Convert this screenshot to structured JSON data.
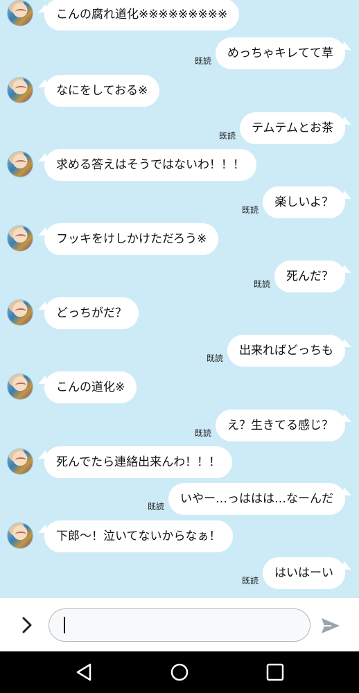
{
  "read_label": "既読",
  "messages": [
    {
      "side": "in",
      "text": "こんの腐れ道化※※※※※※※※※"
    },
    {
      "side": "out",
      "text": "めっちゃキレてて草",
      "read": true
    },
    {
      "side": "in",
      "text": "なにをしておる※"
    },
    {
      "side": "out",
      "text": "テムテムとお茶",
      "read": true
    },
    {
      "side": "in",
      "text": "求める答えはそうではないわ！！！"
    },
    {
      "side": "out",
      "text": "楽しいよ？",
      "read": true
    },
    {
      "side": "in",
      "text": "フッキをけしかけただろう※"
    },
    {
      "side": "out",
      "text": "死んだ？",
      "read": true
    },
    {
      "side": "in",
      "text": "どっちがだ？"
    },
    {
      "side": "out",
      "text": "出来ればどっちも",
      "read": true
    },
    {
      "side": "in",
      "text": "こんの道化※"
    },
    {
      "side": "out",
      "text": "え？生きてる感じ？",
      "read": true
    },
    {
      "side": "in",
      "text": "死んでたら連絡出来んわ！！！"
    },
    {
      "side": "out",
      "text": "いやー…っははは…なーんだ",
      "read": true
    },
    {
      "side": "in",
      "text": "下郎〜！泣いてないからなぁ！"
    },
    {
      "side": "out",
      "text": "はいはーい",
      "read": true
    }
  ],
  "input": {
    "value": "",
    "placeholder": ""
  },
  "icons": {
    "expand": "chevron-right-icon",
    "send": "send-icon",
    "nav_back": "back-triangle-icon",
    "nav_home": "home-circle-icon",
    "nav_recents": "recents-square-icon"
  },
  "colors": {
    "chat_background": "#cdebf7",
    "bubble": "#ffffff",
    "input_bar": "#ffffff",
    "navbar": "#000000",
    "send_icon": "#9aa4ad"
  }
}
